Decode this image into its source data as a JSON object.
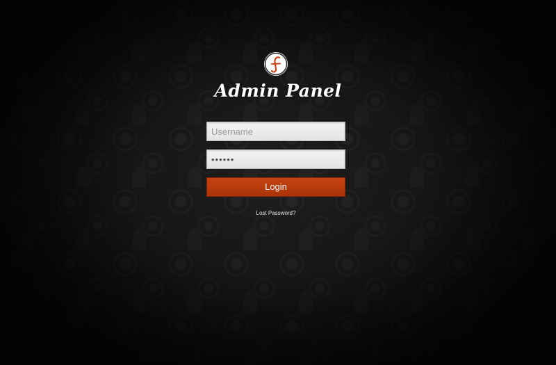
{
  "logo": {
    "icon": "f-script-logo-icon",
    "color": "#c8431a"
  },
  "title": "Admin Panel",
  "form": {
    "username": {
      "placeholder": "Username",
      "value": ""
    },
    "password": {
      "placeholder": "",
      "value": "••••••"
    },
    "login_label": "Login",
    "lost_password_label": "Lost Password?"
  },
  "colors": {
    "accent": "#b63b0d",
    "background": "#1e1e1e"
  }
}
